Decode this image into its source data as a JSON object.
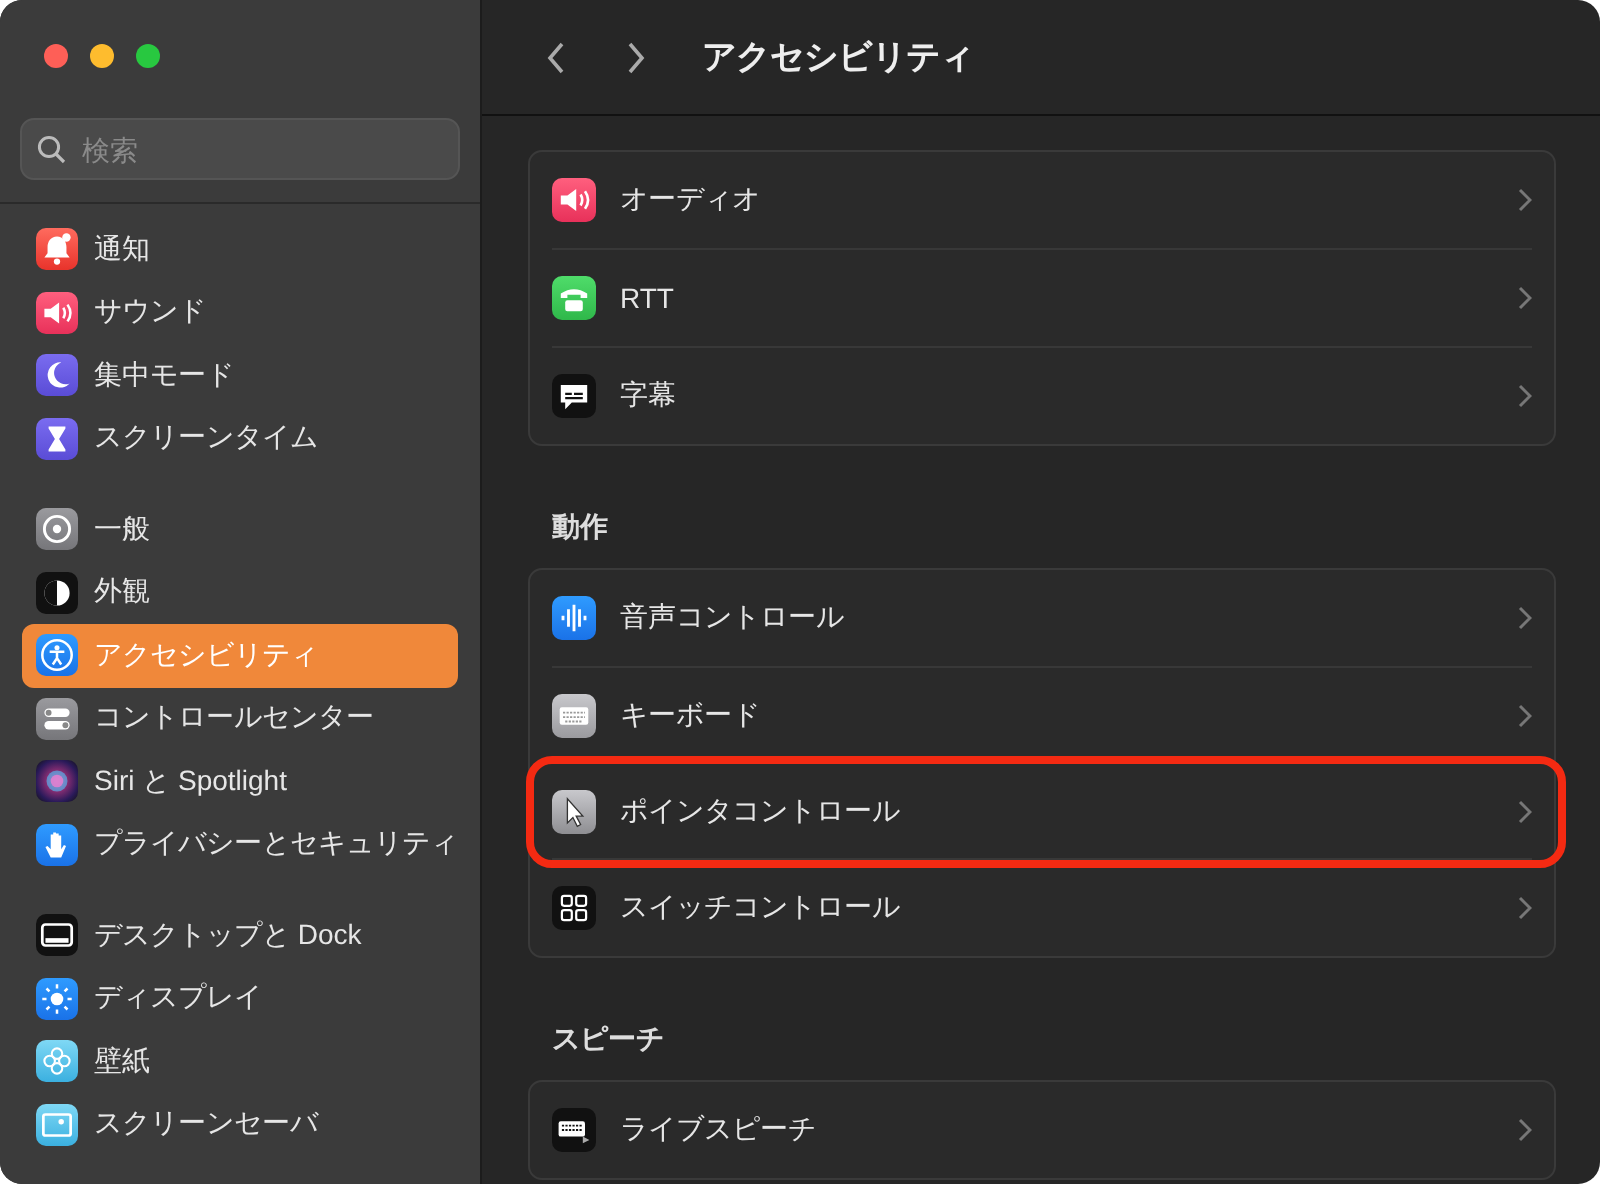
{
  "window": {
    "title": "アクセシビリティ"
  },
  "search": {
    "placeholder": "検索"
  },
  "sidebar": {
    "groups": [
      {
        "items": [
          {
            "label": "通知",
            "selected": false
          },
          {
            "label": "サウンド",
            "selected": false
          },
          {
            "label": "集中モード",
            "selected": false
          },
          {
            "label": "スクリーンタイム",
            "selected": false
          }
        ]
      },
      {
        "items": [
          {
            "label": "一般",
            "selected": false
          },
          {
            "label": "外観",
            "selected": false
          },
          {
            "label": "アクセシビリティ",
            "selected": true
          },
          {
            "label": "コントロールセンター",
            "selected": false
          },
          {
            "label": "Siri と Spotlight",
            "selected": false
          },
          {
            "label": "プライバシーとセキュリティ",
            "selected": false
          }
        ]
      },
      {
        "items": [
          {
            "label": "デスクトップと Dock",
            "selected": false
          },
          {
            "label": "ディスプレイ",
            "selected": false
          },
          {
            "label": "壁紙",
            "selected": false
          },
          {
            "label": "スクリーンセーバ",
            "selected": false
          }
        ]
      }
    ]
  },
  "sections": [
    {
      "rows": [
        {
          "label": "オーディオ",
          "highlighted": false
        },
        {
          "label": "RTT",
          "highlighted": false
        },
        {
          "label": "字幕",
          "highlighted": false
        }
      ]
    },
    {
      "heading": "動作",
      "rows": [
        {
          "label": "音声コントロール",
          "highlighted": false
        },
        {
          "label": "キーボード",
          "highlighted": false
        },
        {
          "label": "ポインタコントロール",
          "highlighted": true
        },
        {
          "label": "スイッチコントロール",
          "highlighted": false
        }
      ]
    },
    {
      "heading": "スピーチ",
      "rows": [
        {
          "label": "ライブスピーチ",
          "highlighted": false
        }
      ]
    }
  ]
}
